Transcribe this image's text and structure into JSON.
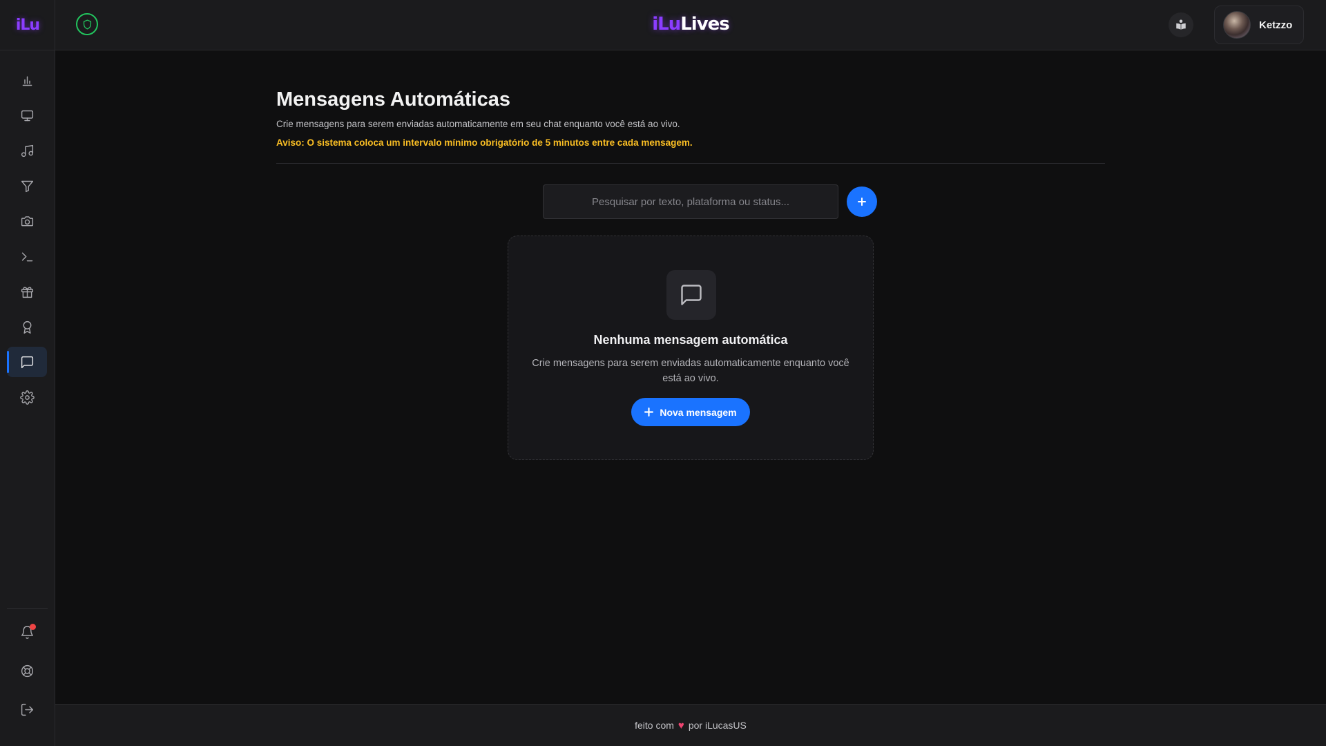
{
  "sidebar": {
    "logo": "iLu",
    "items": [
      {
        "name": "nav-dashboard",
        "icon": "bar-chart-icon",
        "active": false
      },
      {
        "name": "nav-overlays",
        "icon": "monitor-icon",
        "active": false
      },
      {
        "name": "nav-music",
        "icon": "music-icon",
        "active": false
      },
      {
        "name": "nav-filters",
        "icon": "filter-icon",
        "active": false
      },
      {
        "name": "nav-camera",
        "icon": "camera-icon",
        "active": false
      },
      {
        "name": "nav-commands",
        "icon": "terminal-icon",
        "active": false
      },
      {
        "name": "nav-rewards",
        "icon": "gift-icon",
        "active": false
      },
      {
        "name": "nav-achievements",
        "icon": "award-icon",
        "active": false
      },
      {
        "name": "nav-auto-messages",
        "icon": "message-square-icon",
        "active": true
      },
      {
        "name": "nav-settings",
        "icon": "gear-icon",
        "active": false
      }
    ],
    "bottom": [
      {
        "name": "notifications",
        "icon": "bell-icon"
      },
      {
        "name": "support",
        "icon": "life-buoy-icon"
      },
      {
        "name": "logout",
        "icon": "log-out-icon"
      }
    ]
  },
  "header": {
    "brand_prefix": "iLu",
    "brand_suffix": "Lives",
    "user_name": "Ketzzo"
  },
  "main": {
    "title": "Mensagens Automáticas",
    "subtitle": "Crie mensagens para serem enviadas automaticamente em seu chat enquanto você está ao vivo.",
    "warning": "Aviso: O sistema coloca um intervalo mínimo obrigatório de 5 minutos entre cada mensagem.",
    "search_placeholder": "Pesquisar por texto, plataforma ou status...",
    "search_value": ""
  },
  "empty_state": {
    "title": "Nenhuma mensagem automática",
    "description": "Crie mensagens para serem enviadas automaticamente enquanto você está ao vivo.",
    "button_label": "Nova mensagem"
  },
  "footer": {
    "prefix": "feito com",
    "suffix": "por iLucasUS"
  },
  "colors": {
    "accent": "#1a73ff",
    "brand": "#8b3dff",
    "warning": "#fbbf24",
    "status_ok": "#22c55e",
    "notification": "#ef4444"
  }
}
